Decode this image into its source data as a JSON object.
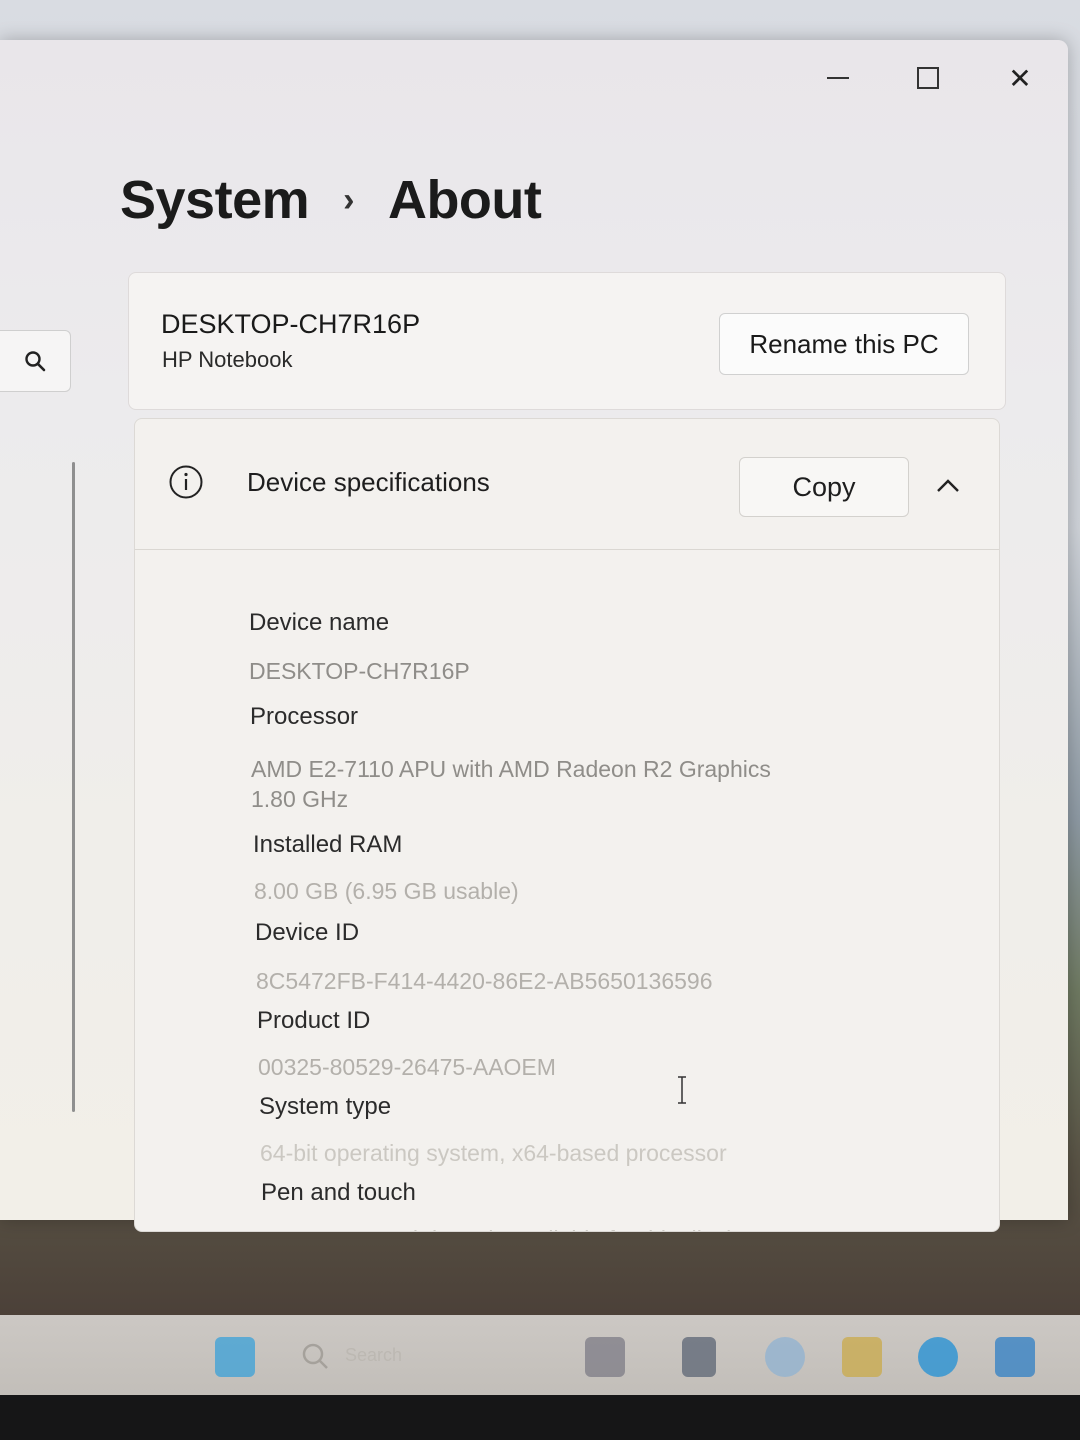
{
  "window": {
    "breadcrumb": {
      "parent": "System",
      "separator": "›",
      "current": "About"
    },
    "controls": {
      "minimize_icon": "minimize-icon",
      "maximize_icon": "maximize-icon",
      "close_icon": "close-icon",
      "close_glyph": "✕"
    }
  },
  "sidebar": {
    "search_icon": "search-icon"
  },
  "pc_card": {
    "name": "DESKTOP-CH7R16P",
    "model": "HP Notebook",
    "rename_label": "Rename this PC"
  },
  "device_specs": {
    "icon": "info-icon",
    "title": "Device specifications",
    "copy_label": "Copy",
    "collapse_icon": "chevron-up-icon",
    "items": [
      {
        "label": "Device name",
        "value": "DESKTOP-CH7R16P"
      },
      {
        "label": "Processor",
        "value": "AMD E2-7110 APU with AMD Radeon R2 Graphics",
        "value_line2": "1.80 GHz"
      },
      {
        "label": "Installed RAM",
        "value": "8.00 GB (6.95 GB usable)"
      },
      {
        "label": "Device ID",
        "value": "8C5472FB-F414-4420-86E2-AB5650136596"
      },
      {
        "label": "Product ID",
        "value": "00325-80529-26475-AAOEM"
      },
      {
        "label": "System type",
        "value": "64-bit operating system, x64-based processor"
      },
      {
        "label": "Pen and touch",
        "value": "No pen or touch input is available for this display"
      }
    ]
  },
  "taskbar": {
    "search_placeholder": "Search",
    "icons": [
      "start-icon",
      "search-icon",
      "file-explorer-icon",
      "widgets-icon",
      "copilot-icon",
      "folder-icon",
      "edge-icon",
      "store-icon"
    ]
  },
  "colors": {
    "accent_edge": "#1f8fd6",
    "text_primary": "#1b1b1b",
    "text_secondary": "#8f8d89"
  }
}
